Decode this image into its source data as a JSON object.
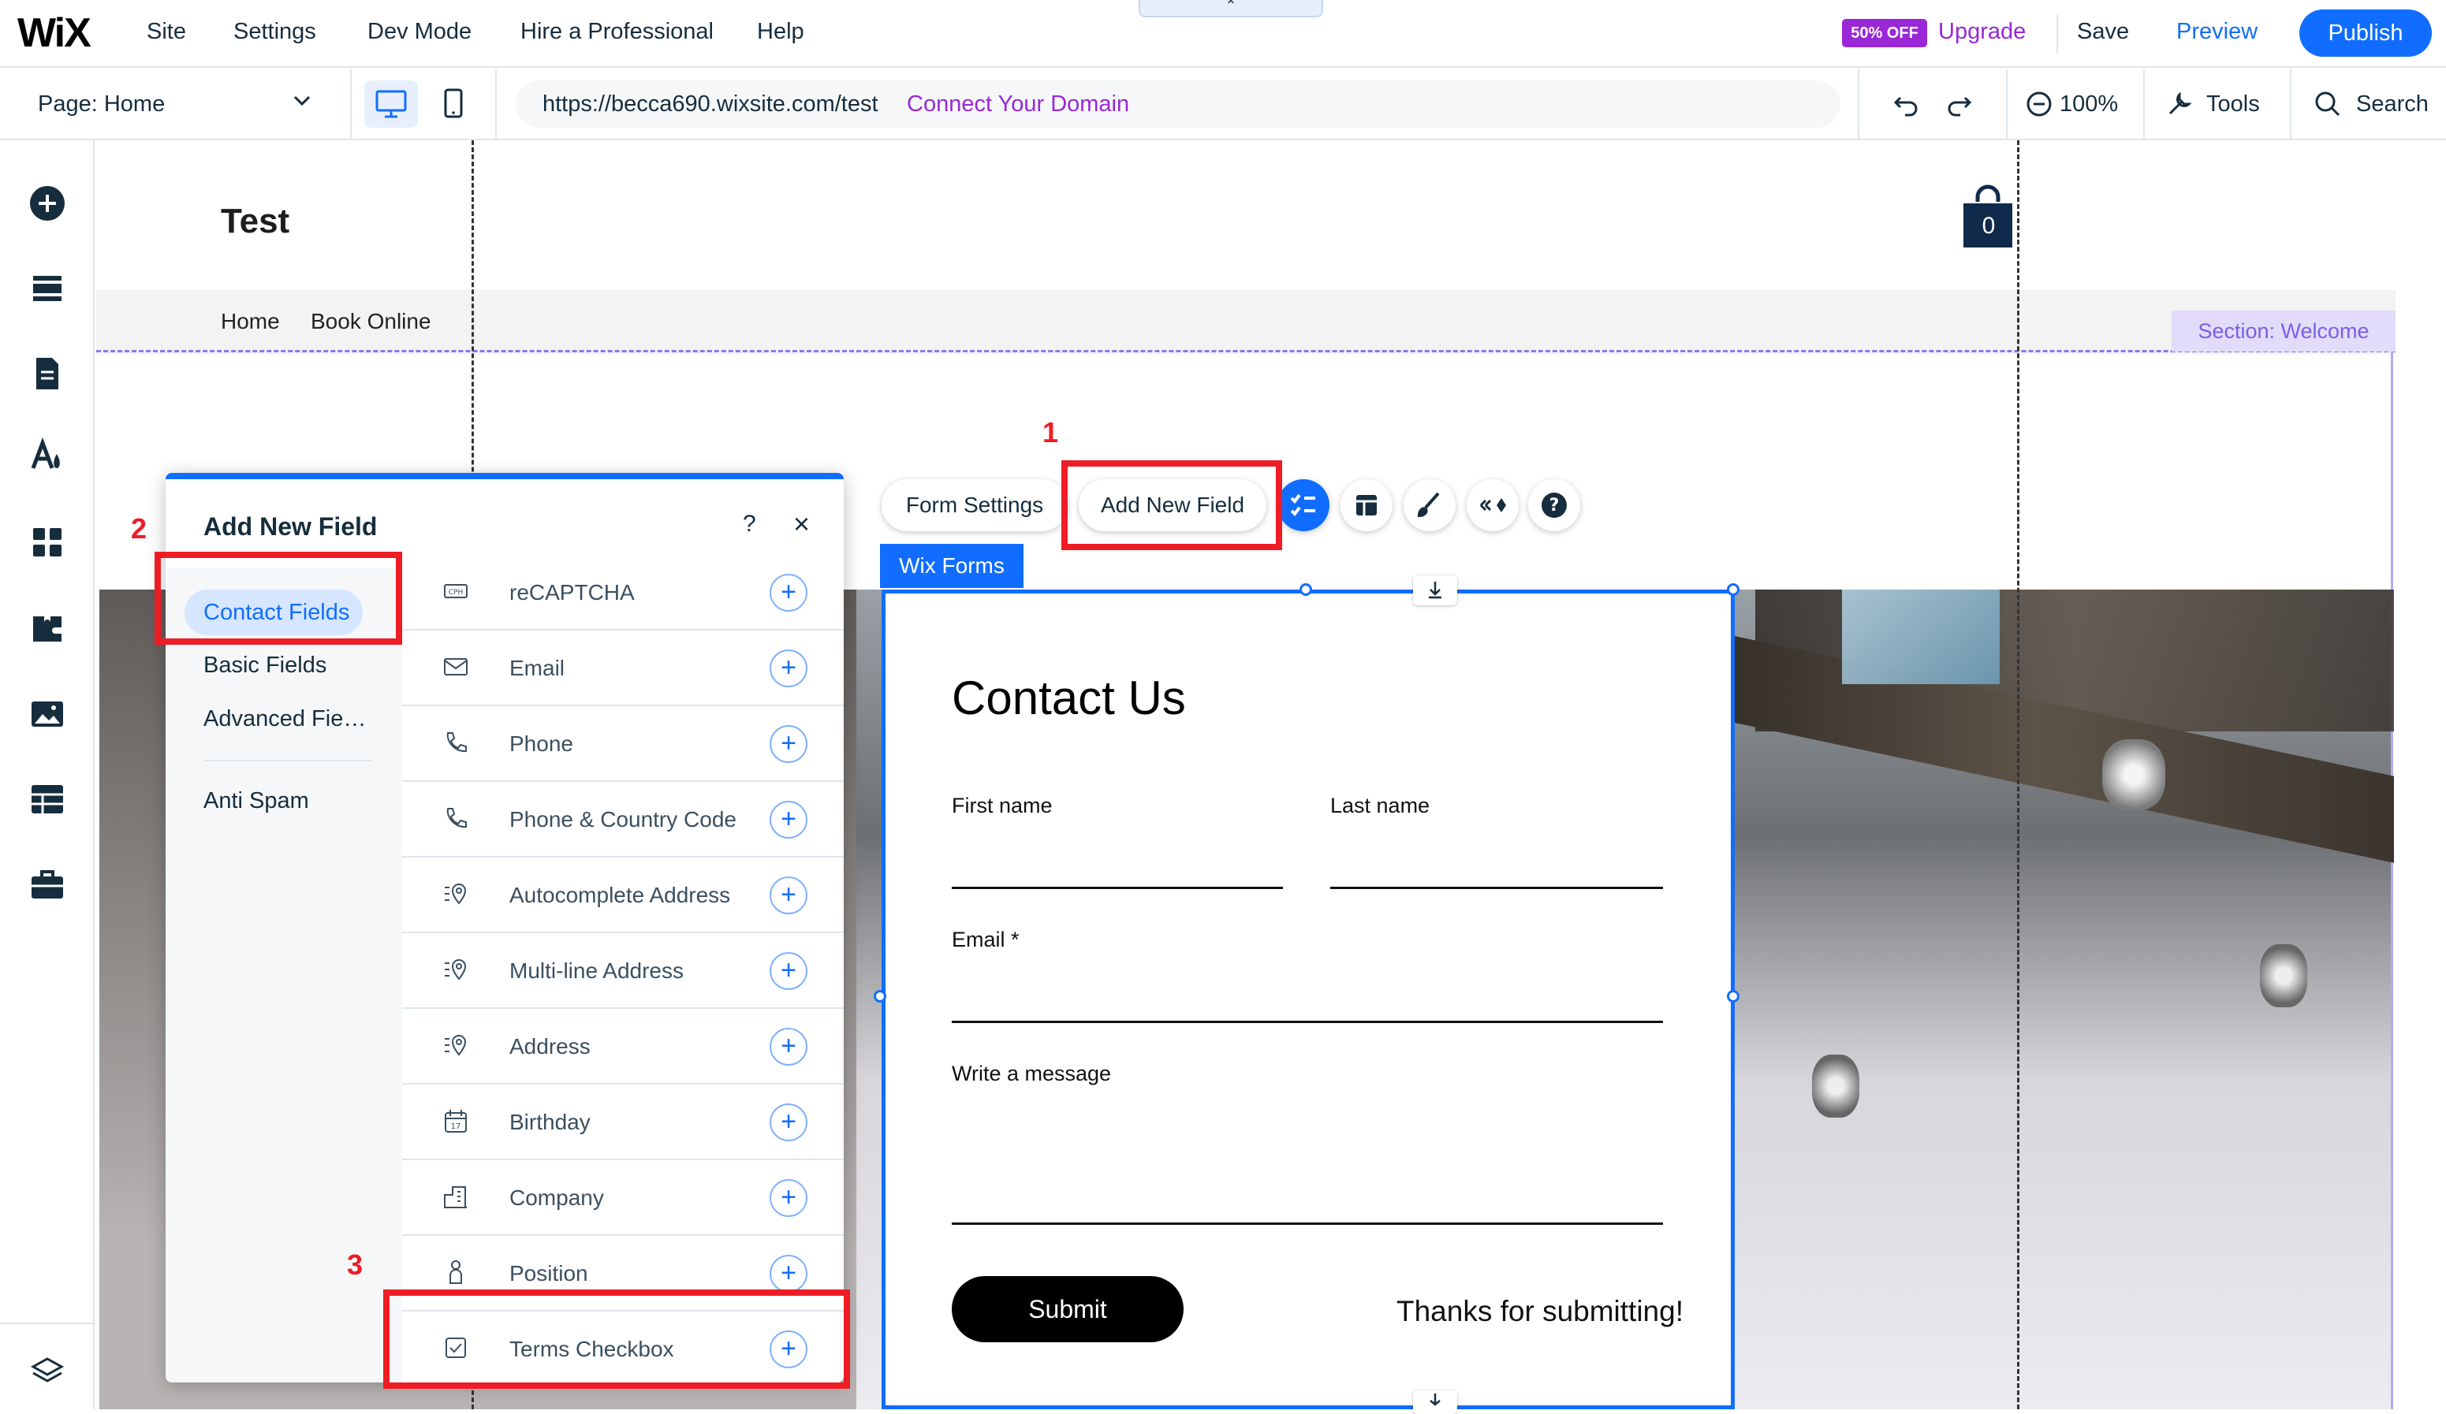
{
  "topbar": {
    "logo": "WiX",
    "menu": [
      "Site",
      "Settings",
      "Dev Mode",
      "Hire a Professional",
      "Help"
    ],
    "badge": "50% OFF",
    "upgrade": "Upgrade",
    "save": "Save",
    "preview": "Preview",
    "publish": "Publish",
    "collapse_tab": "⌃"
  },
  "secondbar": {
    "page_selector": "Page: Home",
    "url": "https://becca690.wixsite.com/test",
    "connect_domain": "Connect Your Domain",
    "zoom": "100%",
    "tools": "Tools",
    "search": "Search"
  },
  "canvas": {
    "site_title": "Test",
    "cart_count": "0",
    "nav": [
      "Home",
      "Book Online"
    ],
    "section_tag": "Section: Welcome"
  },
  "panel": {
    "title": "Add New Field",
    "help": "?",
    "close": "×",
    "categories": {
      "active": "Contact Fields",
      "basic": "Basic Fields",
      "advanced": "Advanced Fie…",
      "antispam": "Anti Spam"
    },
    "fields": [
      "reCAPTCHA",
      "Email",
      "Phone",
      "Phone & Country Code",
      "Autocomplete Address",
      "Multi-line Address",
      "Address",
      "Birthday",
      "Company",
      "Position",
      "Terms Checkbox"
    ]
  },
  "form_toolbar": {
    "form_settings": "Form Settings",
    "add_new_field": "Add New Field",
    "component_tag": "Wix Forms"
  },
  "form": {
    "title": "Contact Us",
    "first_name": "First name",
    "last_name": "Last name",
    "email": "Email *",
    "message": "Write a message",
    "submit": "Submit",
    "thanks": "Thanks for submitting!"
  },
  "annotations": [
    "1",
    "2",
    "3"
  ],
  "colors": {
    "accent": "#116dff",
    "premium": "#9a27d5",
    "annotation": "#ee1c25"
  }
}
